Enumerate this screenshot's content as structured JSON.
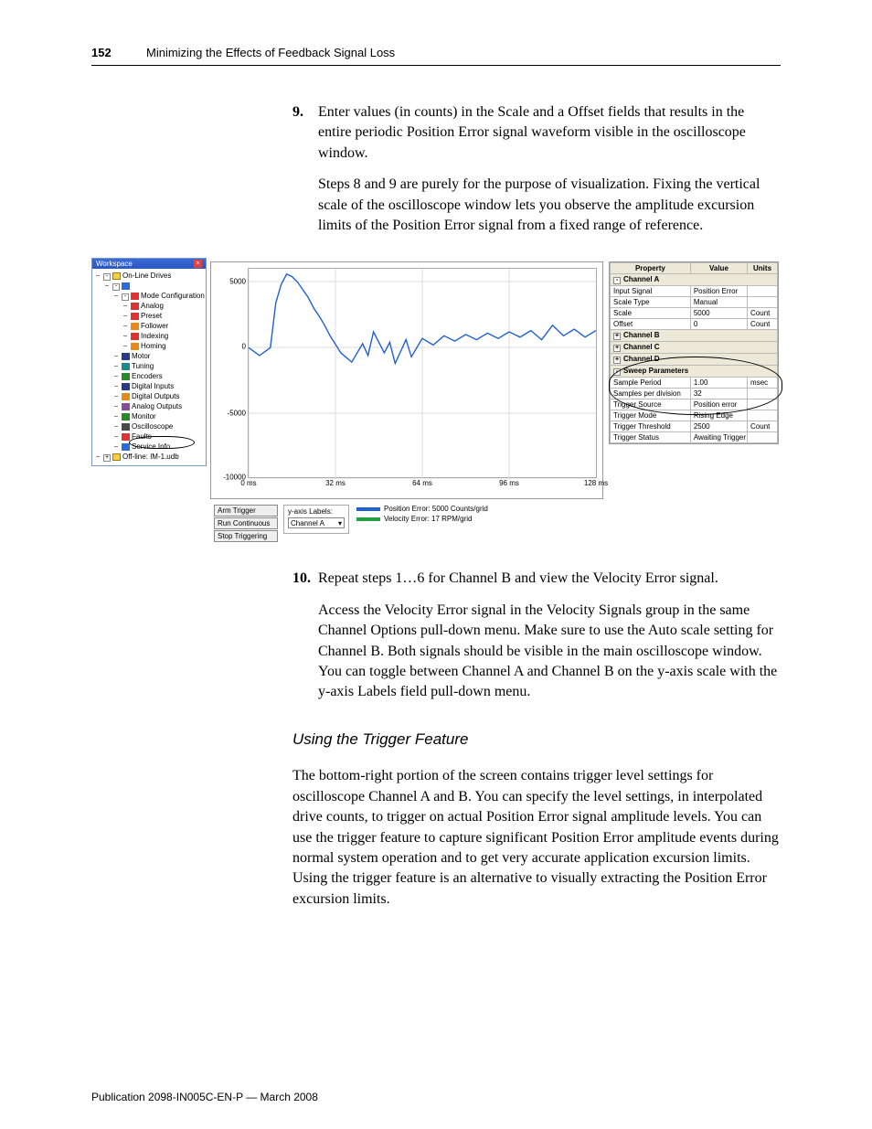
{
  "pageNumber": "152",
  "headerTitle": "Minimizing the Effects of Feedback Signal Loss",
  "step9": {
    "num": "9.",
    "text": "Enter values (in counts) in the Scale and a Offset fields that results in the entire periodic Position Error signal waveform visible in the oscilloscope window.",
    "para": "Steps 8 and 9 are purely for the purpose of visualization. Fixing the vertical scale of the oscilloscope window lets you observe the amplitude excursion limits of the Position Error signal from a fixed range of reference."
  },
  "step10": {
    "num": "10.",
    "text": "Repeat steps 1…6 for Channel B and view the Velocity Error signal.",
    "para": "Access the Velocity Error signal in the Velocity Signals group in the same Channel Options pull-down menu. Make sure to use the Auto scale setting for Channel B. Both signals should be visible in the main oscilloscope window. You can toggle between Channel A and Channel B on the y-axis scale with the y-axis Labels field pull-down menu."
  },
  "subhead": "Using the Trigger Feature",
  "triggerPara": "The bottom-right portion of the screen contains trigger level settings for oscilloscope Channel A and B. You can specify the level settings, in interpolated drive counts, to trigger on actual Position Error signal amplitude levels. You can use the trigger feature to capture significant Position Error amplitude events during normal system operation and to get very accurate application excursion limits. Using the trigger feature is an alternative to visually extracting the Position Error excursion limits.",
  "footer": "Publication 2098-IN005C-EN-P — March 2008",
  "ws": {
    "title": "Workspace",
    "items": [
      "On-Line Drives",
      "Mode Configuration",
      "Analog",
      "Preset",
      "Follower",
      "Indexing",
      "Homing",
      "Motor",
      "Tuning",
      "Encoders",
      "Digital Inputs",
      "Digital Outputs",
      "Analog Outputs",
      "Monitor",
      "Oscilloscope",
      "Faults",
      "Service Info",
      "Off-line: IM-1.udb"
    ]
  },
  "buttons": {
    "arm": "Arm Trigger",
    "run": "Run Continuous",
    "stop": "Stop Triggering"
  },
  "ylabels": {
    "title": "y-axis Labels:",
    "value": "Channel A"
  },
  "legend": {
    "a": "Position Error: 5000 Counts/grid",
    "b": "Velocity Error: 17 RPM/grid"
  },
  "grid": {
    "hProp": "Property",
    "hVal": "Value",
    "hUnit": "Units",
    "chA": "Channel A",
    "chB": "Channel B",
    "chC": "Channel C",
    "chD": "Channel D",
    "sweep": "Sweep Parameters",
    "rows": {
      "inputSignal": {
        "p": "Input Signal",
        "v": "Position Error",
        "u": ""
      },
      "scaleType": {
        "p": "Scale Type",
        "v": "Manual",
        "u": ""
      },
      "scale": {
        "p": "Scale",
        "v": "5000",
        "u": "Count"
      },
      "offset": {
        "p": "Offset",
        "v": "0",
        "u": "Count"
      },
      "samplePeriod": {
        "p": "Sample Period",
        "v": "1.00",
        "u": "msec"
      },
      "spd": {
        "p": "Samples per division",
        "v": "32",
        "u": ""
      },
      "tsrc": {
        "p": "Trigger Source",
        "v": "Position error",
        "u": ""
      },
      "tmode": {
        "p": "Trigger Mode",
        "v": "Rising Edge",
        "u": ""
      },
      "tthresh": {
        "p": "Trigger Threshold",
        "v": "2500",
        "u": "Count"
      },
      "tstatus": {
        "p": "Trigger Status",
        "v": "Awaiting Trigger",
        "u": ""
      }
    }
  },
  "chart_data": {
    "type": "line",
    "title": "",
    "xlabel": "",
    "ylabel": "",
    "x_ticks": [
      "0 ms",
      "32 ms",
      "64 ms",
      "96 ms",
      "128 ms"
    ],
    "y_ticks": [
      -10000,
      -5000,
      0,
      5000
    ],
    "ylim": [
      -10000,
      6000
    ],
    "xlim": [
      0,
      128
    ],
    "series": [
      {
        "name": "Position Error (Counts)",
        "color": "#2060d0",
        "x": [
          0,
          4,
          8,
          10,
          12,
          14,
          16,
          18,
          20,
          22,
          24,
          26,
          28,
          30,
          34,
          38,
          42,
          44,
          46,
          50,
          52,
          54,
          58,
          60,
          64,
          68,
          72,
          76,
          80,
          84,
          88,
          92,
          96,
          100,
          104,
          108,
          112,
          116,
          120,
          124,
          128
        ],
        "values": [
          0,
          -600,
          0,
          3400,
          4800,
          5600,
          5400,
          5000,
          4400,
          3800,
          3000,
          2400,
          1700,
          900,
          -400,
          -1100,
          300,
          -600,
          1200,
          -400,
          400,
          -1200,
          600,
          -700,
          700,
          200,
          900,
          500,
          1000,
          600,
          1100,
          700,
          1200,
          800,
          1300,
          600,
          1700,
          900,
          1400,
          800,
          1300
        ]
      },
      {
        "name": "Velocity Error (RPM)",
        "color": "#20a040",
        "x": [
          0,
          128
        ],
        "values": [
          null,
          null
        ]
      }
    ]
  }
}
